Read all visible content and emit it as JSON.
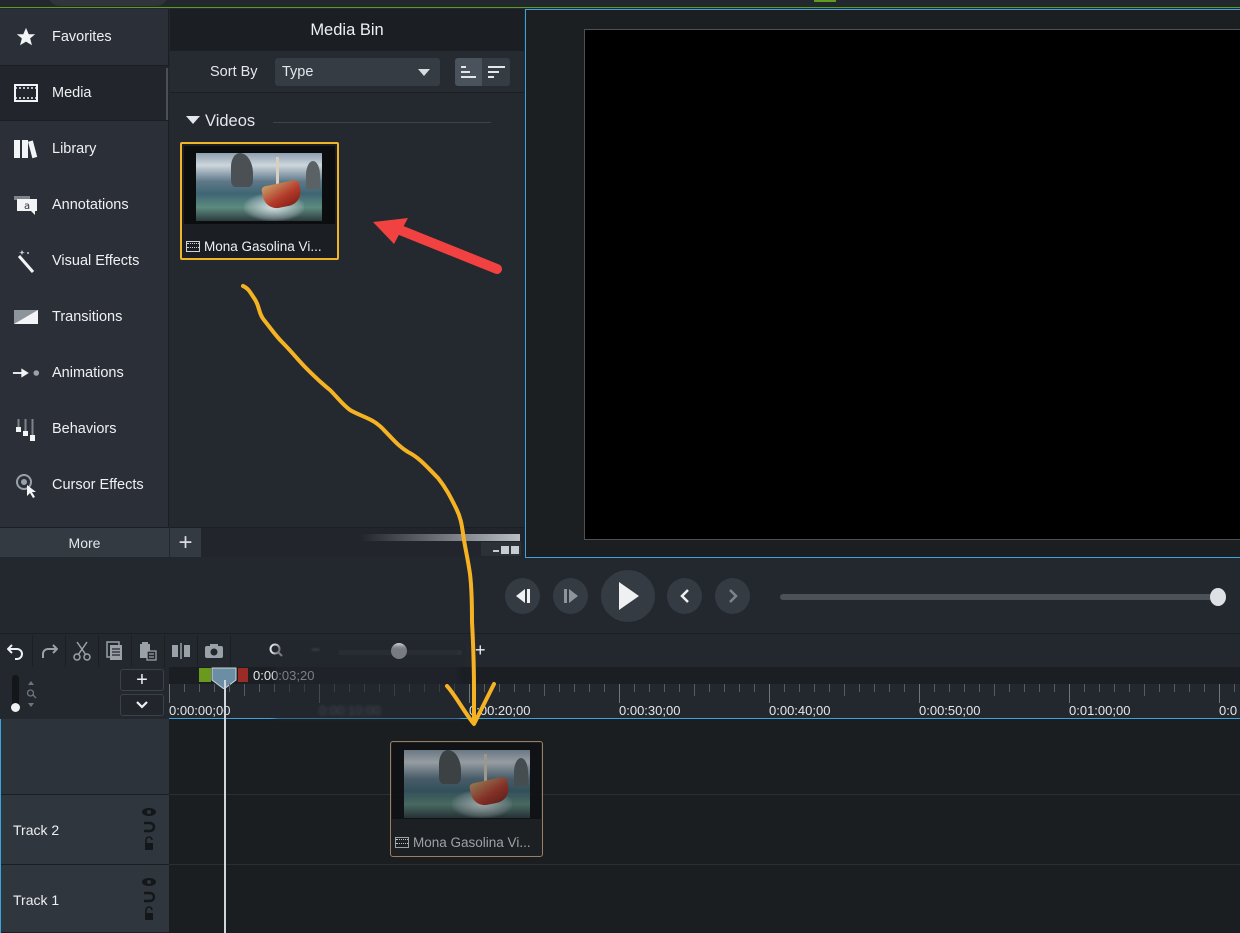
{
  "sidebar": {
    "items": [
      {
        "label": "Favorites",
        "icon": "star-icon",
        "active": false
      },
      {
        "label": "Media",
        "icon": "film-icon",
        "active": true
      },
      {
        "label": "Library",
        "icon": "library-icon",
        "active": false
      },
      {
        "label": "Annotations",
        "icon": "annotation-icon",
        "active": false
      },
      {
        "label": "Visual Effects",
        "icon": "magic-wand-icon",
        "active": false
      },
      {
        "label": "Transitions",
        "icon": "transition-icon",
        "active": false
      },
      {
        "label": "Animations",
        "icon": "animation-icon",
        "active": false
      },
      {
        "label": "Behaviors",
        "icon": "behaviors-icon",
        "active": false
      },
      {
        "label": "Cursor Effects",
        "icon": "cursor-effects-icon",
        "active": false
      }
    ],
    "more_label": "More"
  },
  "media_bin": {
    "title": "Media Bin",
    "sort_label": "Sort By",
    "sort_value": "Type",
    "section_label": "Videos",
    "items": [
      {
        "name": "Mona Gasolina Vi...",
        "type": "video",
        "selected": true
      }
    ],
    "add_label": "+"
  },
  "playback": {
    "buttons": [
      "previous-frame",
      "next-frame",
      "play",
      "previous-marker",
      "next-marker"
    ],
    "scrub_position": 1.0
  },
  "timeline": {
    "toolbar": [
      "undo",
      "redo",
      "cut",
      "copy",
      "paste",
      "split",
      "snapshot"
    ],
    "zoom_in_label": "+",
    "zoom_out_label": "−",
    "zoom_level": 0.5,
    "add_track_label": "+",
    "playhead_time": "0:00:03;20",
    "ruler_labels": [
      "0:00:00;00",
      "0:00:10;00",
      "0:00:20;00",
      "0:00:30;00",
      "0:00:40;00",
      "0:00:50;00",
      "0:01:00;00",
      "0:0"
    ],
    "tracks": [
      {
        "name": "Track 2"
      },
      {
        "name": "Track 1"
      }
    ],
    "clip": {
      "name": "Mona Gasolina Vi...",
      "track": "Track 2"
    }
  },
  "annotations": {
    "arrow_color": "#f24141",
    "drag_path_color": "#f5b324"
  },
  "colors": {
    "accent_blue": "#3ba3e0",
    "accent_green": "#5f9b1f",
    "selection_gold": "#f0b429"
  }
}
